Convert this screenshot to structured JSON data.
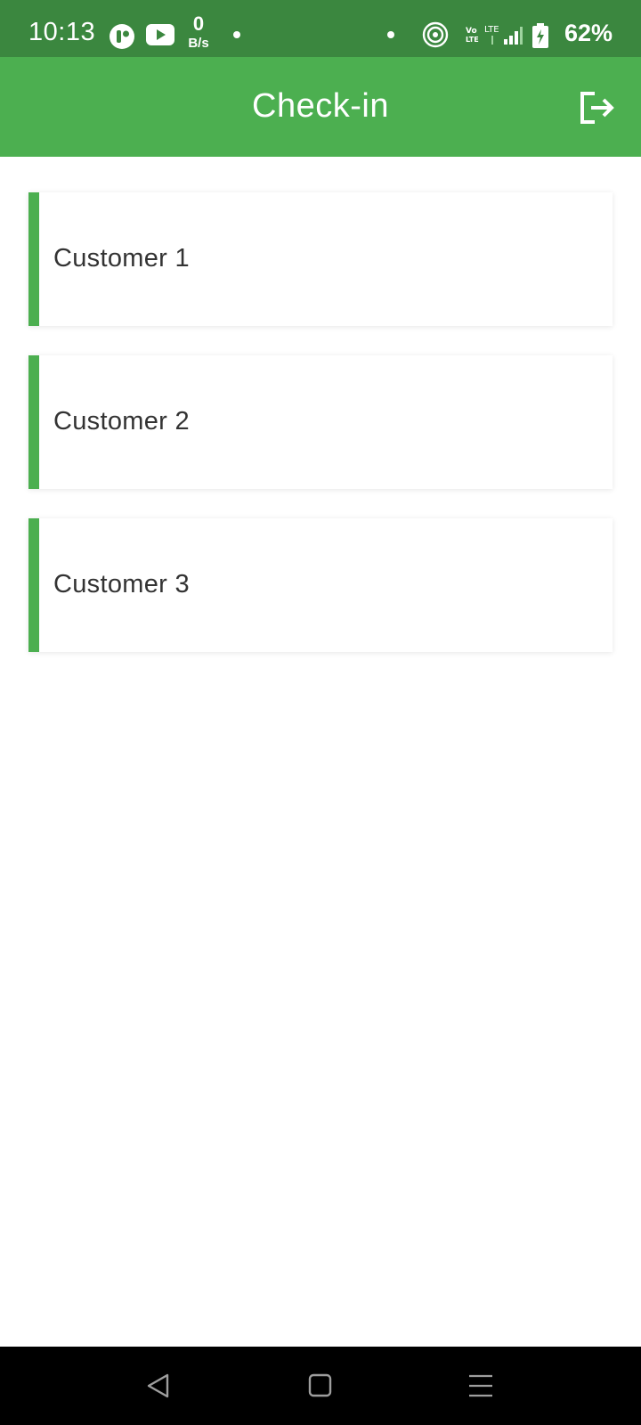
{
  "status_bar": {
    "time": "10:13",
    "net_speed_value": "0",
    "net_speed_unit": "B/s",
    "battery": "62%",
    "icons": [
      "app-notification-icon",
      "youtube-icon",
      "hotspot-icon",
      "volte-icon",
      "lte-signal-icon",
      "battery-charging-icon"
    ]
  },
  "app_bar": {
    "title": "Check-in",
    "logout_icon": "logout-icon"
  },
  "customers": [
    {
      "label": "Customer 1"
    },
    {
      "label": "Customer 2"
    },
    {
      "label": "Customer 3"
    }
  ],
  "nav_bar": {
    "buttons": [
      "back-icon",
      "home-icon",
      "menu-icon"
    ]
  },
  "colors": {
    "status_bar": "#3b873f",
    "app_bar": "#4caf50",
    "accent": "#4caf50",
    "card_text": "#333333"
  }
}
